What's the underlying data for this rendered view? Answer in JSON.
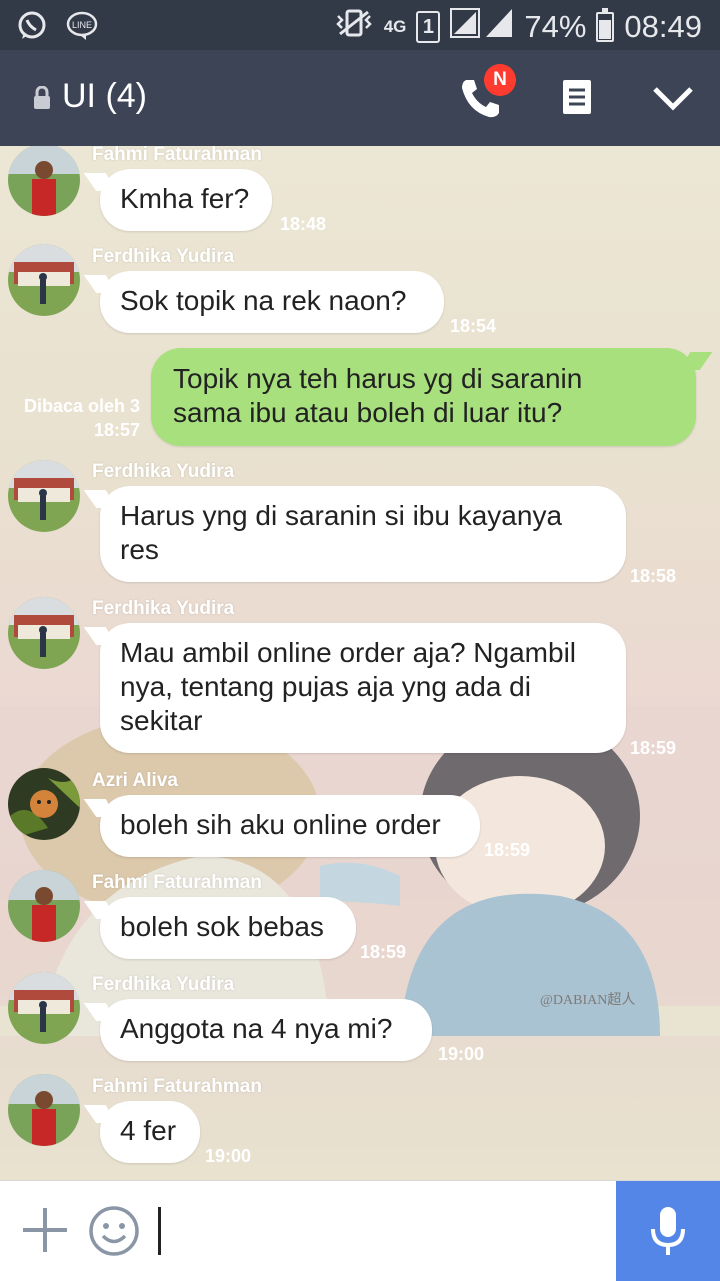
{
  "status_bar": {
    "battery": "74%",
    "time": "08:49",
    "network": "4G",
    "sim": "1",
    "icons": [
      "whatsapp-icon",
      "line-icon",
      "vibrate-icon",
      "signal-icon",
      "battery-icon"
    ]
  },
  "header": {
    "title": "UI (4)",
    "badge": "N",
    "icons": [
      "lock-icon",
      "phone-icon",
      "note-icon",
      "chevron-down-icon"
    ]
  },
  "messages": [
    {
      "sender": "Fahmi Faturahman",
      "text": "Kmha fer?",
      "time": "18:48",
      "avatar": "avatar-fahmi"
    },
    {
      "sender": "Ferdhika Yudira",
      "text": "Sok topik na rek naon?",
      "time": "18:54",
      "avatar": "avatar-ferdhika"
    },
    {
      "outgoing": true,
      "read": "Dibaca oleh 3",
      "text_lines": [
        "Topik nya teh harus yg di saranin",
        "sama ibu atau boleh di luar itu?"
      ],
      "time": "18:57"
    },
    {
      "sender": "Ferdhika Yudira",
      "text_lines": [
        "Harus yng di saranin si ibu kayanya",
        "res"
      ],
      "time": "18:58",
      "avatar": "avatar-ferdhika"
    },
    {
      "sender": "Ferdhika Yudira",
      "text_lines": [
        "Mau ambil online order aja? Ngambil",
        "nya, tentang pujas aja yng ada di",
        "sekitar"
      ],
      "time": "18:59",
      "avatar": "avatar-ferdhika"
    },
    {
      "sender": "Azri Aliva",
      "text": "boleh sih aku online order",
      "time": "18:59",
      "avatar": "avatar-azri"
    },
    {
      "sender": "Fahmi Faturahman",
      "text": "boleh sok bebas",
      "time": "18:59",
      "avatar": "avatar-fahmi"
    },
    {
      "sender": "Ferdhika Yudira",
      "text": "Anggota na 4 nya mi?",
      "time": "19:00",
      "avatar": "avatar-ferdhika"
    },
    {
      "sender": "Fahmi Faturahman",
      "text": "4 fer",
      "time": "19:00",
      "avatar": "avatar-fahmi"
    }
  ],
  "input_bar": {
    "icons": [
      "plus-icon",
      "emoji-icon",
      "mic-icon"
    ],
    "accent": "#5486e8"
  },
  "background_watermark": "@DABIAN超人",
  "colors": {
    "status_bar": "#323947",
    "header": "#3d4456",
    "outgoing_bubble": "#a8e07e",
    "incoming_bubble": "#ffffff",
    "badge": "#ff3b30"
  }
}
